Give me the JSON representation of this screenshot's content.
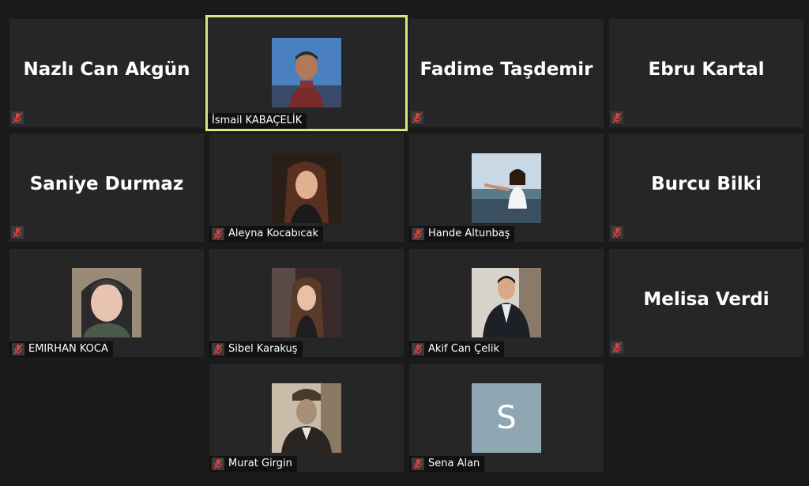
{
  "participants": [
    {
      "name": "Nazlı Can Akgün",
      "muted": true,
      "video": false
    },
    {
      "name": "İsmail KABAÇELİK",
      "muted": false,
      "video": true,
      "active_speaker": true
    },
    {
      "name": "Fadime Taşdemir",
      "muted": true,
      "video": false
    },
    {
      "name": "Ebru Kartal",
      "muted": true,
      "video": false
    },
    {
      "name": "Saniye Durmaz",
      "muted": true,
      "video": false
    },
    {
      "name": "Aleyna Kocabıcak",
      "muted": true,
      "video": true
    },
    {
      "name": "Hande Altunbaş",
      "muted": true,
      "video": true
    },
    {
      "name": "Burcu Bilki",
      "muted": true,
      "video": false
    },
    {
      "name": "EMIRHAN KOCA",
      "muted": true,
      "video": true
    },
    {
      "name": "Sibel Karakuş",
      "muted": true,
      "video": true
    },
    {
      "name": "Akif Can Çelik",
      "muted": true,
      "video": true
    },
    {
      "name": "Melisa Verdi",
      "muted": true,
      "video": false
    },
    {
      "name": "Murat Girgin",
      "muted": true,
      "video": true
    },
    {
      "name": "Sena Alan",
      "muted": true,
      "video": false,
      "avatar_initial": "S"
    }
  ],
  "colors": {
    "background": "#1a1a1a",
    "tile": "#262626",
    "active_border": "#d8e87a",
    "muted_icon": "#e04040",
    "avatar_initial_bg": "#8fa7b3"
  },
  "icons": {
    "mute": "microphone-muted-icon"
  }
}
